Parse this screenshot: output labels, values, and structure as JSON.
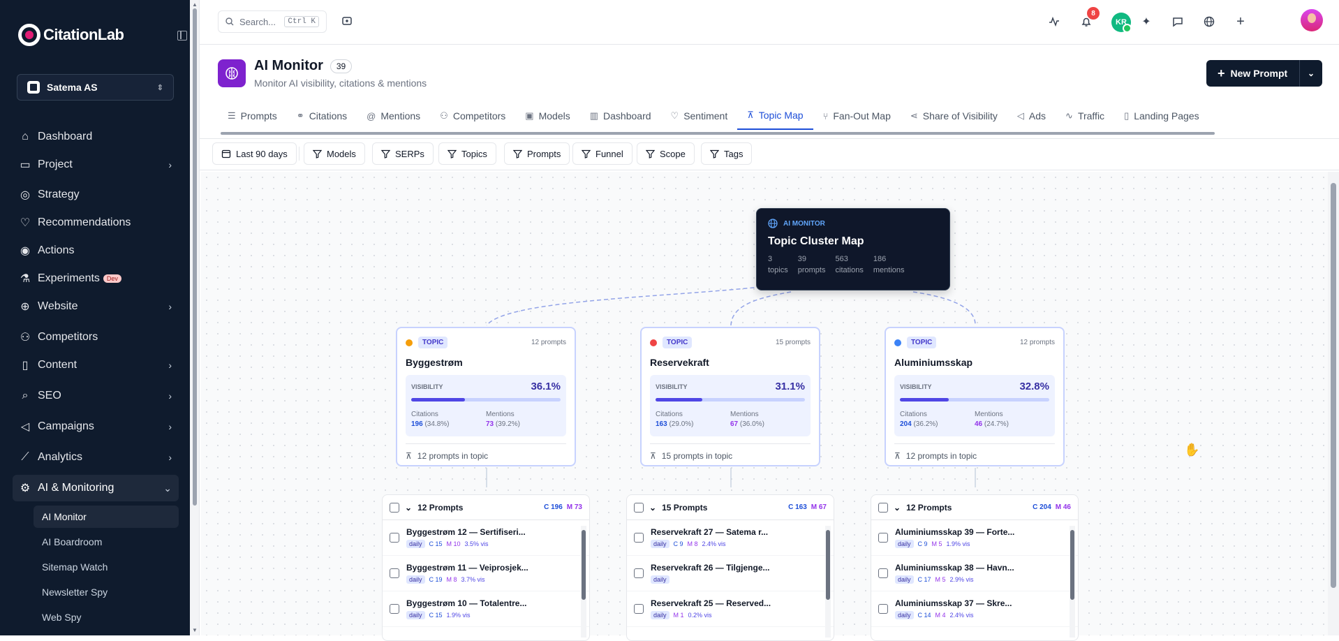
{
  "app": {
    "brand": "CitationLab",
    "org": "Satema AS"
  },
  "sidebar": {
    "items": [
      {
        "label": "Dashboard",
        "icon": "home-icon"
      },
      {
        "label": "Project",
        "icon": "folder-icon",
        "expandable": true
      },
      {
        "label": "Strategy",
        "icon": "compass-icon"
      },
      {
        "label": "Recommendations",
        "icon": "lightbulb-icon"
      },
      {
        "label": "Actions",
        "icon": "target-icon"
      },
      {
        "label": "Experiments",
        "icon": "flask-icon",
        "badge": "Dev"
      },
      {
        "label": "Website",
        "icon": "globe-icon",
        "expandable": true
      },
      {
        "label": "Competitors",
        "icon": "users-icon"
      },
      {
        "label": "Content",
        "icon": "book-icon",
        "expandable": true
      },
      {
        "label": "SEO",
        "icon": "search-icon",
        "expandable": true
      },
      {
        "label": "Campaigns",
        "icon": "megaphone-icon",
        "expandable": true
      },
      {
        "label": "Analytics",
        "icon": "chart-line-icon",
        "expandable": true
      },
      {
        "label": "AI & Monitoring",
        "icon": "brain-icon",
        "expanded": true
      }
    ],
    "subitems": [
      "AI Monitor",
      "AI Boardroom",
      "Sitemap Watch",
      "Newsletter Spy",
      "Web Spy"
    ]
  },
  "topbar": {
    "search_placeholder": "Search...",
    "shortcut": "Ctrl K",
    "notifications": "8",
    "user_initials": "KR"
  },
  "header": {
    "title": "AI Monitor",
    "count": "39",
    "subtitle": "Monitor AI visibility, citations & mentions",
    "new_button": "New Prompt"
  },
  "tabs": [
    {
      "label": "Prompts",
      "icon": "list-icon"
    },
    {
      "label": "Citations",
      "icon": "link-icon"
    },
    {
      "label": "Mentions",
      "icon": "at-icon"
    },
    {
      "label": "Competitors",
      "icon": "users-icon"
    },
    {
      "label": "Models",
      "icon": "cpu-icon"
    },
    {
      "label": "Dashboard",
      "icon": "bar-chart-icon"
    },
    {
      "label": "Sentiment",
      "icon": "lightbulb-icon"
    },
    {
      "label": "Topic Map",
      "icon": "network-icon",
      "active": true
    },
    {
      "label": "Fan-Out Map",
      "icon": "fork-icon"
    },
    {
      "label": "Share of Visibility",
      "icon": "share-icon"
    },
    {
      "label": "Ads",
      "icon": "megaphone-icon"
    },
    {
      "label": "Traffic",
      "icon": "activity-icon"
    },
    {
      "label": "Landing Pages",
      "icon": "file-icon"
    }
  ],
  "filters": {
    "date": "Last 90 days",
    "items": [
      "Models",
      "SERPs",
      "Topics",
      "Prompts",
      "Funnel",
      "Scope",
      "Tags"
    ]
  },
  "root": {
    "label": "AI MONITOR",
    "title": "Topic Cluster Map",
    "stats": [
      {
        "v": "3",
        "l": "topics"
      },
      {
        "v": "39",
        "l": "prompts"
      },
      {
        "v": "563",
        "l": "citations"
      },
      {
        "v": "186",
        "l": "mentions"
      }
    ]
  },
  "topics": [
    {
      "pill": "TOPIC",
      "prompts": "12 prompts",
      "name": "Byggestrøm",
      "color": "#f59e0b",
      "vis_label": "VISIBILITY",
      "visibility": "36.1%",
      "vis_value": 0.361,
      "citations_label": "Citations",
      "citations": "196",
      "citations_pct": "(34.8%)",
      "mentions_label": "Mentions",
      "mentions": "73",
      "mentions_pct": "(39.2%)",
      "footer": "12 prompts in topic"
    },
    {
      "pill": "TOPIC",
      "prompts": "15 prompts",
      "name": "Reservekraft",
      "color": "#ef4444",
      "vis_label": "VISIBILITY",
      "visibility": "31.1%",
      "vis_value": 0.311,
      "citations_label": "Citations",
      "citations": "163",
      "citations_pct": "(29.0%)",
      "mentions_label": "Mentions",
      "mentions": "67",
      "mentions_pct": "(36.0%)",
      "footer": "15 prompts in topic"
    },
    {
      "pill": "TOPIC",
      "prompts": "12 prompts",
      "name": "Aluminiumsskap",
      "color": "#3b82f6",
      "vis_label": "VISIBILITY",
      "visibility": "32.8%",
      "vis_value": 0.328,
      "citations_label": "Citations",
      "citations": "204",
      "citations_pct": "(36.2%)",
      "mentions_label": "Mentions",
      "mentions": "46",
      "mentions_pct": "(24.7%)",
      "footer": "12 prompts in topic"
    }
  ],
  "prompt_lists": [
    {
      "header": "12 Prompts",
      "c": "C 196",
      "m": "M 73",
      "items": [
        {
          "title": "Byggestrøm 12 — Sertifiseri...",
          "tag": "daily",
          "c": "C 15",
          "m": "M 10",
          "vis": "3.5% vis"
        },
        {
          "title": "Byggestrøm 11 — Veiprosjek...",
          "tag": "daily",
          "c": "C 19",
          "m": "M 8",
          "vis": "3.7% vis"
        },
        {
          "title": "Byggestrøm 10 — Totalentre...",
          "tag": "daily",
          "c": "C 15",
          "m": "",
          "vis": "1.9% vis"
        }
      ]
    },
    {
      "header": "15 Prompts",
      "c": "C 163",
      "m": "M 67",
      "items": [
        {
          "title": "Reservekraft 27 — Satema r...",
          "tag": "daily",
          "c": "C 9",
          "m": "M 8",
          "vis": "2.4% vis"
        },
        {
          "title": "Reservekraft 26 — Tilgjenge...",
          "tag": "daily",
          "c": "",
          "m": "",
          "vis": ""
        },
        {
          "title": "Reservekraft 25 — Reserved...",
          "tag": "daily",
          "c": "",
          "m": "M 1",
          "vis": "0.2% vis"
        }
      ]
    },
    {
      "header": "12 Prompts",
      "c": "C 204",
      "m": "M 46",
      "items": [
        {
          "title": "Aluminiumsskap 39 — Forte...",
          "tag": "daily",
          "c": "C 9",
          "m": "M 5",
          "vis": "1.9% vis"
        },
        {
          "title": "Aluminiumsskap 38 — Havn...",
          "tag": "daily",
          "c": "C 17",
          "m": "M 5",
          "vis": "2.9% vis"
        },
        {
          "title": "Aluminiumsskap 37 — Skre...",
          "tag": "daily",
          "c": "C 14",
          "m": "M 4",
          "vis": "2.4% vis"
        }
      ]
    }
  ]
}
